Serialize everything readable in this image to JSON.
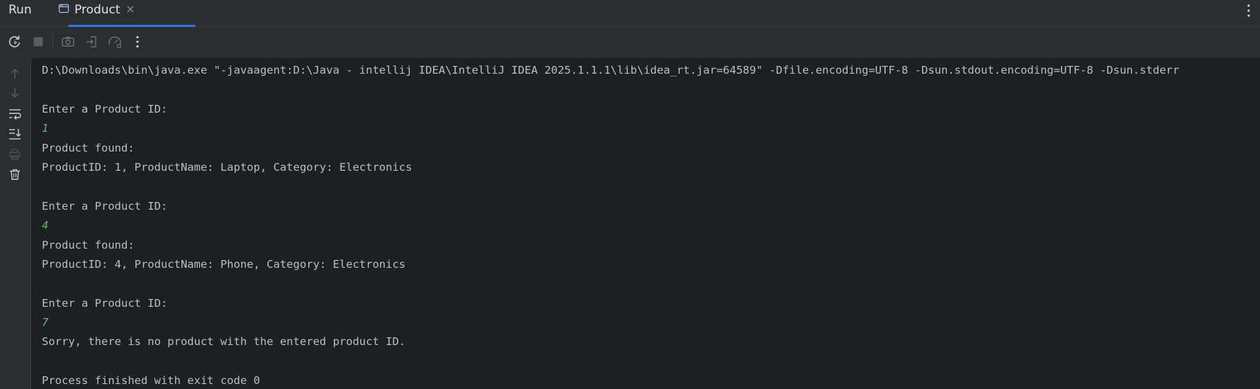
{
  "tool_window": {
    "title": "Run",
    "tab_label": "Product"
  },
  "toolbar": {
    "buttons": [
      "rerun-icon",
      "stop-icon",
      "screenshot-icon",
      "login-icon",
      "profiler-icon",
      "more-vertical-icon"
    ]
  },
  "gutter": {
    "buttons": [
      "arrow-up-icon",
      "arrow-down-icon",
      "soft-wrap-icon",
      "scroll-to-end-icon",
      "print-icon",
      "trash-icon"
    ]
  },
  "console": {
    "lines": [
      {
        "text": "D:\\Downloads\\bin\\java.exe \"-javaagent:D:\\Java - intellij IDEA\\IntelliJ IDEA 2025.1.1.1\\lib\\idea_rt.jar=64589\" -Dfile.encoding=UTF-8 -Dsun.stdout.encoding=UTF-8 -Dsun.stderr",
        "kind": "output"
      },
      {
        "text": "",
        "kind": "output"
      },
      {
        "text": "Enter a Product ID:",
        "kind": "output"
      },
      {
        "text": "1",
        "kind": "input"
      },
      {
        "text": "Product found:",
        "kind": "output"
      },
      {
        "text": "ProductID: 1, ProductName: Laptop, Category: Electronics",
        "kind": "output"
      },
      {
        "text": "",
        "kind": "output"
      },
      {
        "text": "Enter a Product ID:",
        "kind": "output"
      },
      {
        "text": "4",
        "kind": "input"
      },
      {
        "text": "Product found:",
        "kind": "output"
      },
      {
        "text": "ProductID: 4, ProductName: Phone, Category: Electronics",
        "kind": "output"
      },
      {
        "text": "",
        "kind": "output"
      },
      {
        "text": "Enter a Product ID:",
        "kind": "output"
      },
      {
        "text": "7",
        "kind": "input"
      },
      {
        "text": "Sorry, there is no product with the entered product ID.",
        "kind": "output"
      },
      {
        "text": "",
        "kind": "output"
      },
      {
        "text": "Process finished with exit code 0",
        "kind": "output"
      }
    ]
  },
  "colors": {
    "accent": "#3574f0",
    "user_input": "#5fb865",
    "console_text": "#bcbec4",
    "background": "#1e1f22",
    "panel": "#2b2d30"
  }
}
